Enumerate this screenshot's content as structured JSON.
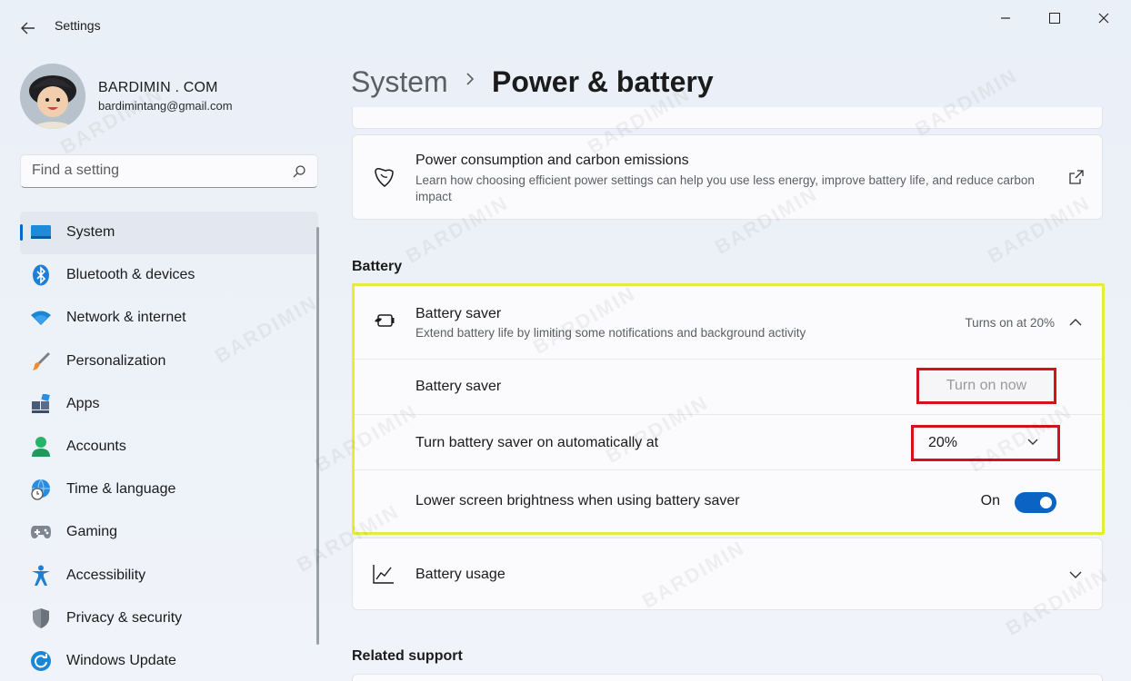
{
  "window": {
    "title": "Settings"
  },
  "profile": {
    "name": "BARDIMIN . COM",
    "email": "bardimintang@gmail.com"
  },
  "search": {
    "placeholder": "Find a setting"
  },
  "sidebar": {
    "items": [
      {
        "label": "System",
        "icon": "monitor-icon",
        "active": true
      },
      {
        "label": "Bluetooth & devices",
        "icon": "bluetooth-icon"
      },
      {
        "label": "Network & internet",
        "icon": "wifi-icon"
      },
      {
        "label": "Personalization",
        "icon": "brush-icon"
      },
      {
        "label": "Apps",
        "icon": "apps-icon"
      },
      {
        "label": "Accounts",
        "icon": "person-icon"
      },
      {
        "label": "Time & language",
        "icon": "globe-clock-icon"
      },
      {
        "label": "Gaming",
        "icon": "gamepad-icon"
      },
      {
        "label": "Accessibility",
        "icon": "accessibility-icon"
      },
      {
        "label": "Privacy & security",
        "icon": "shield-icon"
      },
      {
        "label": "Windows Update",
        "icon": "update-icon"
      }
    ]
  },
  "breadcrumb": {
    "parent": "System",
    "current": "Power & battery"
  },
  "power_card": {
    "title": "Power consumption and carbon emissions",
    "description": "Learn how choosing efficient power settings can help you use less energy, improve battery life, and reduce carbon impact"
  },
  "battery_section": {
    "heading": "Battery",
    "saver": {
      "title": "Battery saver",
      "description": "Extend battery life by limiting some notifications and background activity",
      "status": "Turns on at 20%"
    },
    "row_saver": {
      "label": "Battery saver",
      "button": "Turn on now"
    },
    "row_auto": {
      "label": "Turn battery saver on automatically at",
      "value": "20%"
    },
    "row_brightness": {
      "label": "Lower screen brightness when using battery saver",
      "state": "On"
    },
    "usage": {
      "title": "Battery usage"
    }
  },
  "related": {
    "heading": "Related support"
  },
  "colors": {
    "accent": "#0b63c4",
    "highlight_yellow": "#e5ec3a",
    "highlight_red": "#d4111f"
  }
}
